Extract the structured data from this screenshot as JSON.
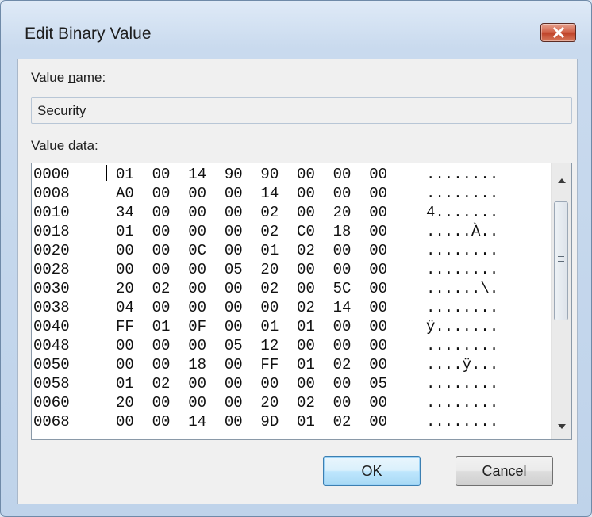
{
  "window": {
    "title": "Edit Binary Value"
  },
  "value_name": {
    "label_pre": "Value ",
    "label_mnemonic": "n",
    "label_post": "ame:",
    "value": "Security"
  },
  "value_data": {
    "label_mnemonic": "V",
    "label_post": "alue data:",
    "rows": [
      {
        "offset": "0000",
        "bytes": "01  00  14  90  90  00  00  00",
        "ascii": "........"
      },
      {
        "offset": "0008",
        "bytes": "A0  00  00  00  14  00  00  00",
        "ascii": "........"
      },
      {
        "offset": "0010",
        "bytes": "34  00  00  00  02  00  20  00",
        "ascii": "4......."
      },
      {
        "offset": "0018",
        "bytes": "01  00  00  00  02  C0  18  00",
        "ascii": ".....À.."
      },
      {
        "offset": "0020",
        "bytes": "00  00  0C  00  01  02  00  00",
        "ascii": "........"
      },
      {
        "offset": "0028",
        "bytes": "00  00  00  05  20  00  00  00",
        "ascii": "........"
      },
      {
        "offset": "0030",
        "bytes": "20  02  00  00  02  00  5C  00",
        "ascii": "......\\."
      },
      {
        "offset": "0038",
        "bytes": "04  00  00  00  00  02  14  00",
        "ascii": "........"
      },
      {
        "offset": "0040",
        "bytes": "FF  01  0F  00  01  01  00  00",
        "ascii": "ÿ......."
      },
      {
        "offset": "0048",
        "bytes": "00  00  00  05  12  00  00  00",
        "ascii": "........"
      },
      {
        "offset": "0050",
        "bytes": "00  00  18  00  FF  01  02  00",
        "ascii": "....ÿ..."
      },
      {
        "offset": "0058",
        "bytes": "01  02  00  00  00  00  00  05",
        "ascii": "........"
      },
      {
        "offset": "0060",
        "bytes": "20  00  00  00  20  02  00  00",
        "ascii": "........"
      },
      {
        "offset": "0068",
        "bytes": "00  00  14  00  9D  01  02  00",
        "ascii": "........"
      }
    ]
  },
  "buttons": {
    "ok": "OK",
    "cancel": "Cancel"
  },
  "icons": {
    "close": "close-icon",
    "scroll_up": "arrow-up-icon",
    "scroll_down": "arrow-down-icon"
  },
  "colors": {
    "close_button": "#c75237",
    "ok_button_border": "#3c7fb1"
  }
}
